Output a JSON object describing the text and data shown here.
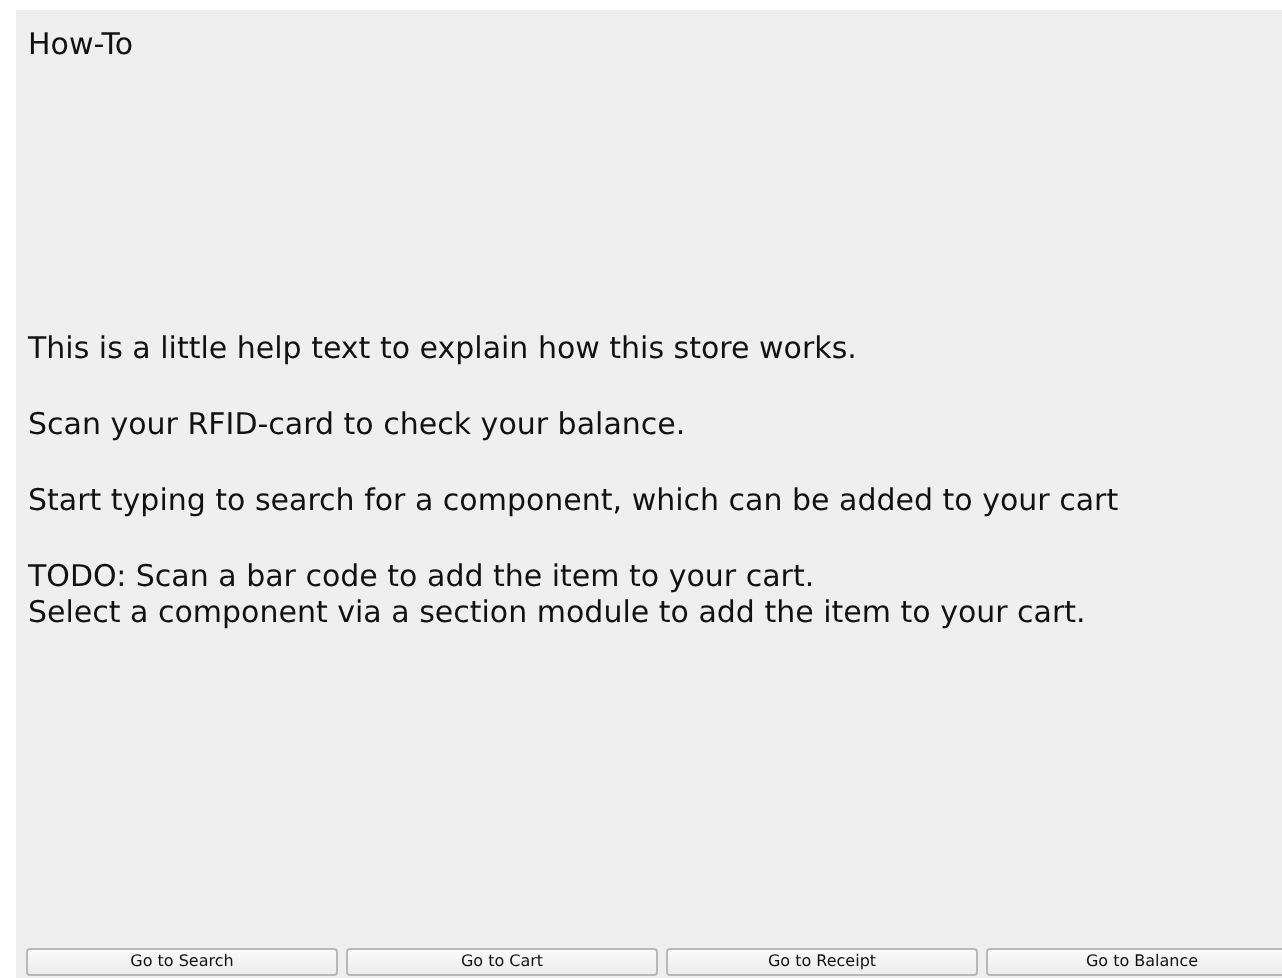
{
  "title": "How-To",
  "paragraphs": [
    [
      "This is a little help text to explain how this store works."
    ],
    [
      "Scan your RFID-card to check your balance."
    ],
    [
      "Start typing to search for a component, which can be added to your cart"
    ],
    [
      "TODO: Scan a bar code to add the item to your cart.",
      "Select a component via a section module to add the item to your cart."
    ]
  ],
  "buttons": [
    "Go to Search",
    "Go to Cart",
    "Go to Receipt",
    "Go to Balance"
  ]
}
